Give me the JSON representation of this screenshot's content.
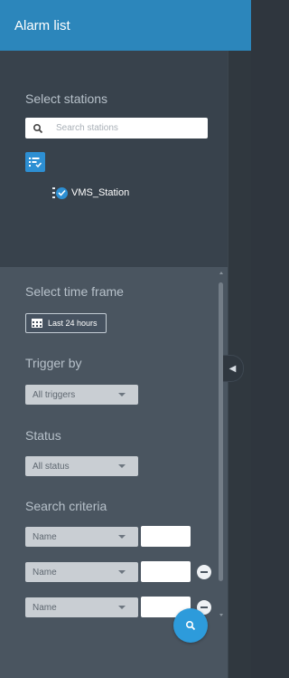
{
  "header": {
    "title": "Alarm list"
  },
  "stations": {
    "label": "Select stations",
    "search_placeholder": "Search stations",
    "tree": [
      {
        "name": "VMS_Station",
        "checked": true
      }
    ]
  },
  "filters": {
    "time_frame": {
      "label": "Select time frame",
      "value": "Last 24 hours"
    },
    "trigger": {
      "label": "Trigger by",
      "value": "All triggers"
    },
    "status": {
      "label": "Status",
      "value": "All status"
    },
    "criteria": {
      "label": "Search criteria",
      "rows": [
        {
          "field": "Name",
          "value": "",
          "removable": false
        },
        {
          "field": "Name",
          "value": "",
          "removable": true
        },
        {
          "field": "Name",
          "value": "",
          "removable": true
        }
      ]
    }
  },
  "colors": {
    "header": "#2c86bb",
    "accent": "#2d8fd3",
    "panel_dark": "#38424c",
    "panel_light": "#4a5560"
  },
  "icons": {
    "search": "search-icon",
    "tree_toggle": "list-check-icon",
    "calendar": "calendar-icon",
    "collapse": "chevron-left-icon",
    "remove": "minus-circle-icon"
  }
}
